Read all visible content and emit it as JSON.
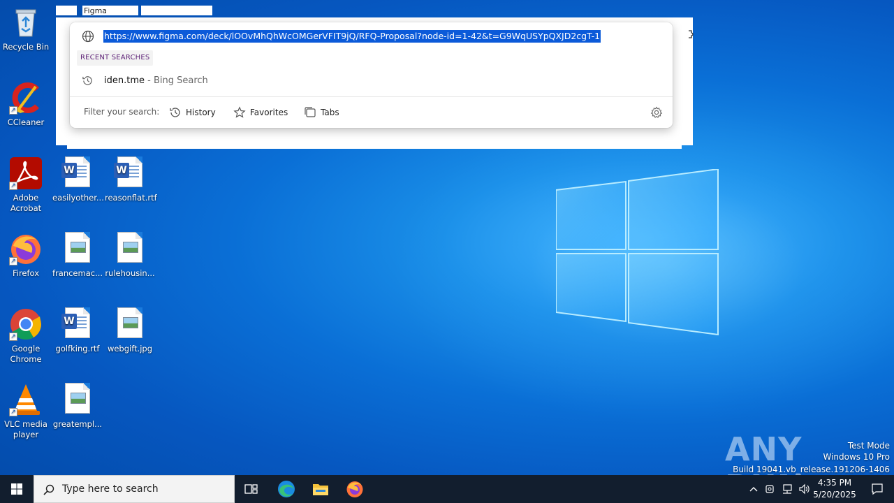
{
  "desktop": {
    "icons": [
      {
        "label": "Recycle Bin",
        "icon": "recycle-bin-icon"
      },
      {
        "label": "CCleaner",
        "icon": "ccleaner-icon"
      },
      {
        "label": "Adobe Acrobat",
        "icon": "adobe-acrobat-icon"
      },
      {
        "label": "easilyother...",
        "icon": "word-document-icon"
      },
      {
        "label": "reasonflat.rtf",
        "icon": "word-document-icon"
      },
      {
        "label": "Firefox",
        "icon": "firefox-icon"
      },
      {
        "label": "francemac...",
        "icon": "image-file-icon"
      },
      {
        "label": "rulehousin...",
        "icon": "image-file-icon"
      },
      {
        "label": "Google Chrome",
        "icon": "chrome-icon"
      },
      {
        "label": "golfking.rtf",
        "icon": "word-document-icon"
      },
      {
        "label": "webgift.jpg",
        "icon": "image-file-icon"
      },
      {
        "label": "VLC media player",
        "icon": "vlc-icon"
      },
      {
        "label": "greatempl...",
        "icon": "image-file-icon"
      }
    ]
  },
  "browser": {
    "tab_title": "Figma",
    "address_bar": {
      "url": "https://www.figma.com/deck/lOOvMhQhWcOMGerVFIT9jQ/RFQ-Proposal?node-id=1-42&t=G9WqUSYpQXJD2cgT-1",
      "selected": true
    },
    "suggestions": {
      "section_label": "RECENT SEARCHES",
      "items": [
        {
          "query": "iden.tme",
          "suffix": " - Bing Search",
          "icon": "history-icon"
        }
      ]
    },
    "filter": {
      "label": "Filter your search:",
      "chips": [
        {
          "label": "History",
          "icon": "history-icon"
        },
        {
          "label": "Favorites",
          "icon": "star-icon"
        },
        {
          "label": "Tabs",
          "icon": "tabs-icon"
        }
      ],
      "settings_icon": "gear-icon"
    }
  },
  "watermark": {
    "brand": "ANY RUN",
    "line1": "Test Mode",
    "line2": "Windows 10 Pro",
    "line3": "Build 19041.vb_release.191206-1406"
  },
  "taskbar": {
    "search_placeholder": "Type here to search",
    "pinned": [
      "task-view-icon",
      "edge-icon",
      "file-explorer-icon",
      "firefox-icon"
    ],
    "clock": {
      "time": "4:35 PM",
      "date": "5/20/2025"
    },
    "colors": {
      "accent": "#0b5ad9",
      "taskbar": "#121e2e"
    }
  }
}
